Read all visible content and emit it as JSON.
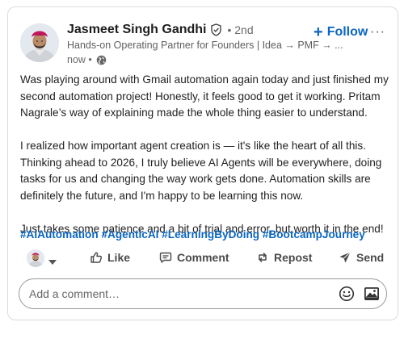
{
  "author": {
    "name": "Jasmeet Singh Gandhi",
    "degree": "• 2nd",
    "headline": "Hands-on Operating Partner for Founders | Idea → PMF → ...",
    "time": "now •"
  },
  "header": {
    "follow_label": "Follow",
    "follow_plus": "+",
    "more_label": "···"
  },
  "post": {
    "paragraphs": [
      "Was playing around with Gmail automation again today and just finished my second automation project! Honestly, it feels good to get it working. Pritam Nagrale’s way of explaining made the whole thing easier to understand.",
      "I realized how important agent creation is — it's like the heart of all this. Thinking ahead to 2026, I truly believe AI Agents will be everywhere, doing tasks for us and changing the way work gets done. Automation skills are definitely the future, and I'm happy to be learning this now.",
      "Just takes some patience and a bit of trial and error, but worth it in the end!"
    ],
    "hashtags": [
      "#AIAutomation",
      "#AgenticAI",
      "#LearningByDoing",
      "#BootcampJourney"
    ]
  },
  "actions": {
    "like": "Like",
    "comment": "Comment",
    "repost": "Repost",
    "send": "Send"
  },
  "comment_box": {
    "placeholder": "Add a comment…"
  },
  "colors": {
    "accent": "#0a66c2",
    "text": "#222222",
    "muted": "#6b6b6b"
  },
  "icons": [
    "verified-shield-icon",
    "globe-icon",
    "caret-down-icon",
    "like-icon",
    "comment-icon",
    "repost-icon",
    "send-icon",
    "emoji-icon",
    "image-icon"
  ]
}
